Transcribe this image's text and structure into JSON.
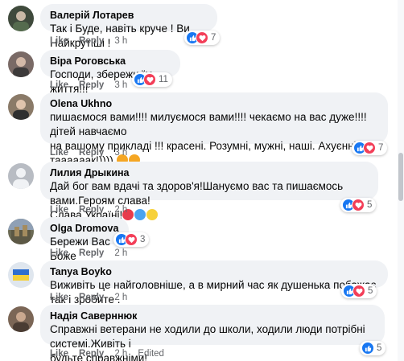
{
  "comments": [
    {
      "author": "Валерій Лотарев",
      "text": "Так і Буде, навіть круче ! Ви Найкрутіші !",
      "like": "Like",
      "reply": "Reply",
      "time": "3 h",
      "reactions": "7",
      "avatar_color": "#3f4a3c"
    },
    {
      "author": "Віра Роговська",
      "text": "Господи, збережи їм життя!!!",
      "like": "Like",
      "reply": "Reply",
      "time": "3 h",
      "reactions": "11",
      "avatar_color": "#7a6a66"
    },
    {
      "author": "Olena Ukhno",
      "text_line1": "пишаємося вами!!!! милуємося вами!!!! чекаємо на вас дуже!!!! дітей навчаємо",
      "text_line2": "на вашому прикладі !!! красені. Розумні, мужні, наші. Ахуєнні, таааааак!))))",
      "like": "Like",
      "reply": "Reply",
      "time": "3 h",
      "reactions": "7",
      "avatar_color": "#8a7a68"
    },
    {
      "author": "Лилия Дрыкина",
      "text_line1": "Дай бог вам вдачі та здоров'я!Шануємо вас та пишаємось вами.Героям слава!",
      "text_line2": "Слава Україні!",
      "like": "Like",
      "reply": "Reply",
      "time": "2 h",
      "reactions": "5",
      "avatar_color": "#b8bcc3"
    },
    {
      "author": "Olga Dromova",
      "text": "Бережи Вас Боже",
      "like": "Like",
      "reply": "Reply",
      "time": "2 h",
      "reactions": "3",
      "avatar_color": "#6b6a55"
    },
    {
      "author": "Tanya Boyko",
      "text": "Виживіть це найголовніше, а в мирний час як душенька побажає так і зробите .",
      "like": "Like",
      "reply": "Reply",
      "time": "2 h",
      "reactions": "5",
      "avatar_color": "#dfe6ee"
    },
    {
      "author": "Надія Саверннюк",
      "text_line1": "Справжні ветерани не ходили до школи, ходили люди потрібні системі.Живіть і",
      "text_line2": "будьте справжніми!",
      "like": "Like",
      "reply": "Reply",
      "time": "2 h",
      "edited": "Edited",
      "reactions": "5",
      "avatar_color": "#7b6656"
    }
  ],
  "icons": [
    "like-icon",
    "love-icon",
    "muscle-emoji",
    "praying-hands-emoji",
    "heart-emoji",
    "cat-heart-eyes-emoji"
  ],
  "colors": {
    "meta": "#65676b",
    "bubble": "#f0f2f5",
    "like": "#1877f2",
    "love": "#f33e58"
  }
}
